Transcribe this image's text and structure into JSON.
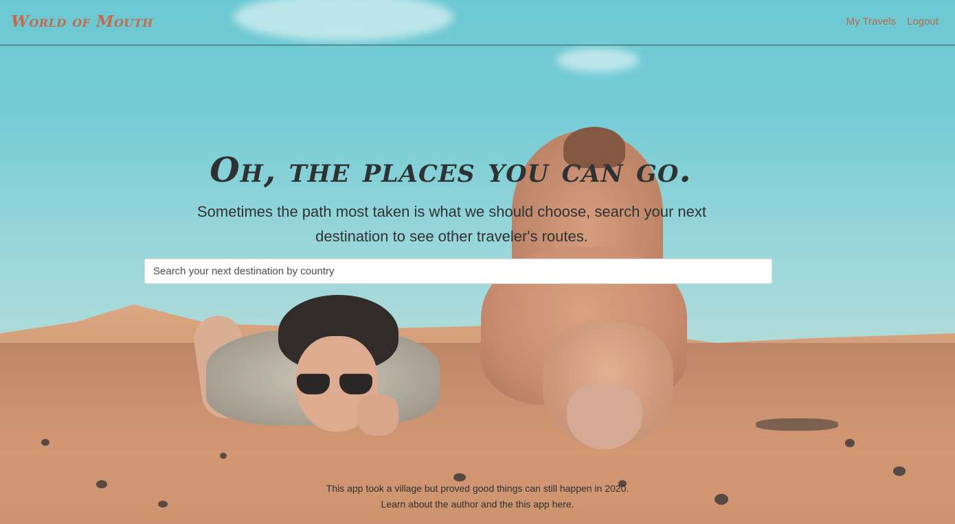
{
  "navbar": {
    "brand": "World of Mouth",
    "links": [
      "My Travels",
      "Logout"
    ]
  },
  "hero": {
    "title": "Oh, the places you can go.",
    "subtitle": "Sometimes the path most taken is what we should choose, search your next destination to see other traveler's routes."
  },
  "search": {
    "placeholder": "Search your next destination by country",
    "value": ""
  },
  "footer": {
    "line1": "This app took a village but proved good things can still happen in 2020.",
    "line2_prefix": "Learn about the author and the this app ",
    "line2_link": "here."
  },
  "colors": {
    "brand": "#c26b4f",
    "nav_link": "#b26a4f",
    "heading": "#2f3232",
    "sky": "#6cc8d2",
    "sand": "#c48763"
  }
}
